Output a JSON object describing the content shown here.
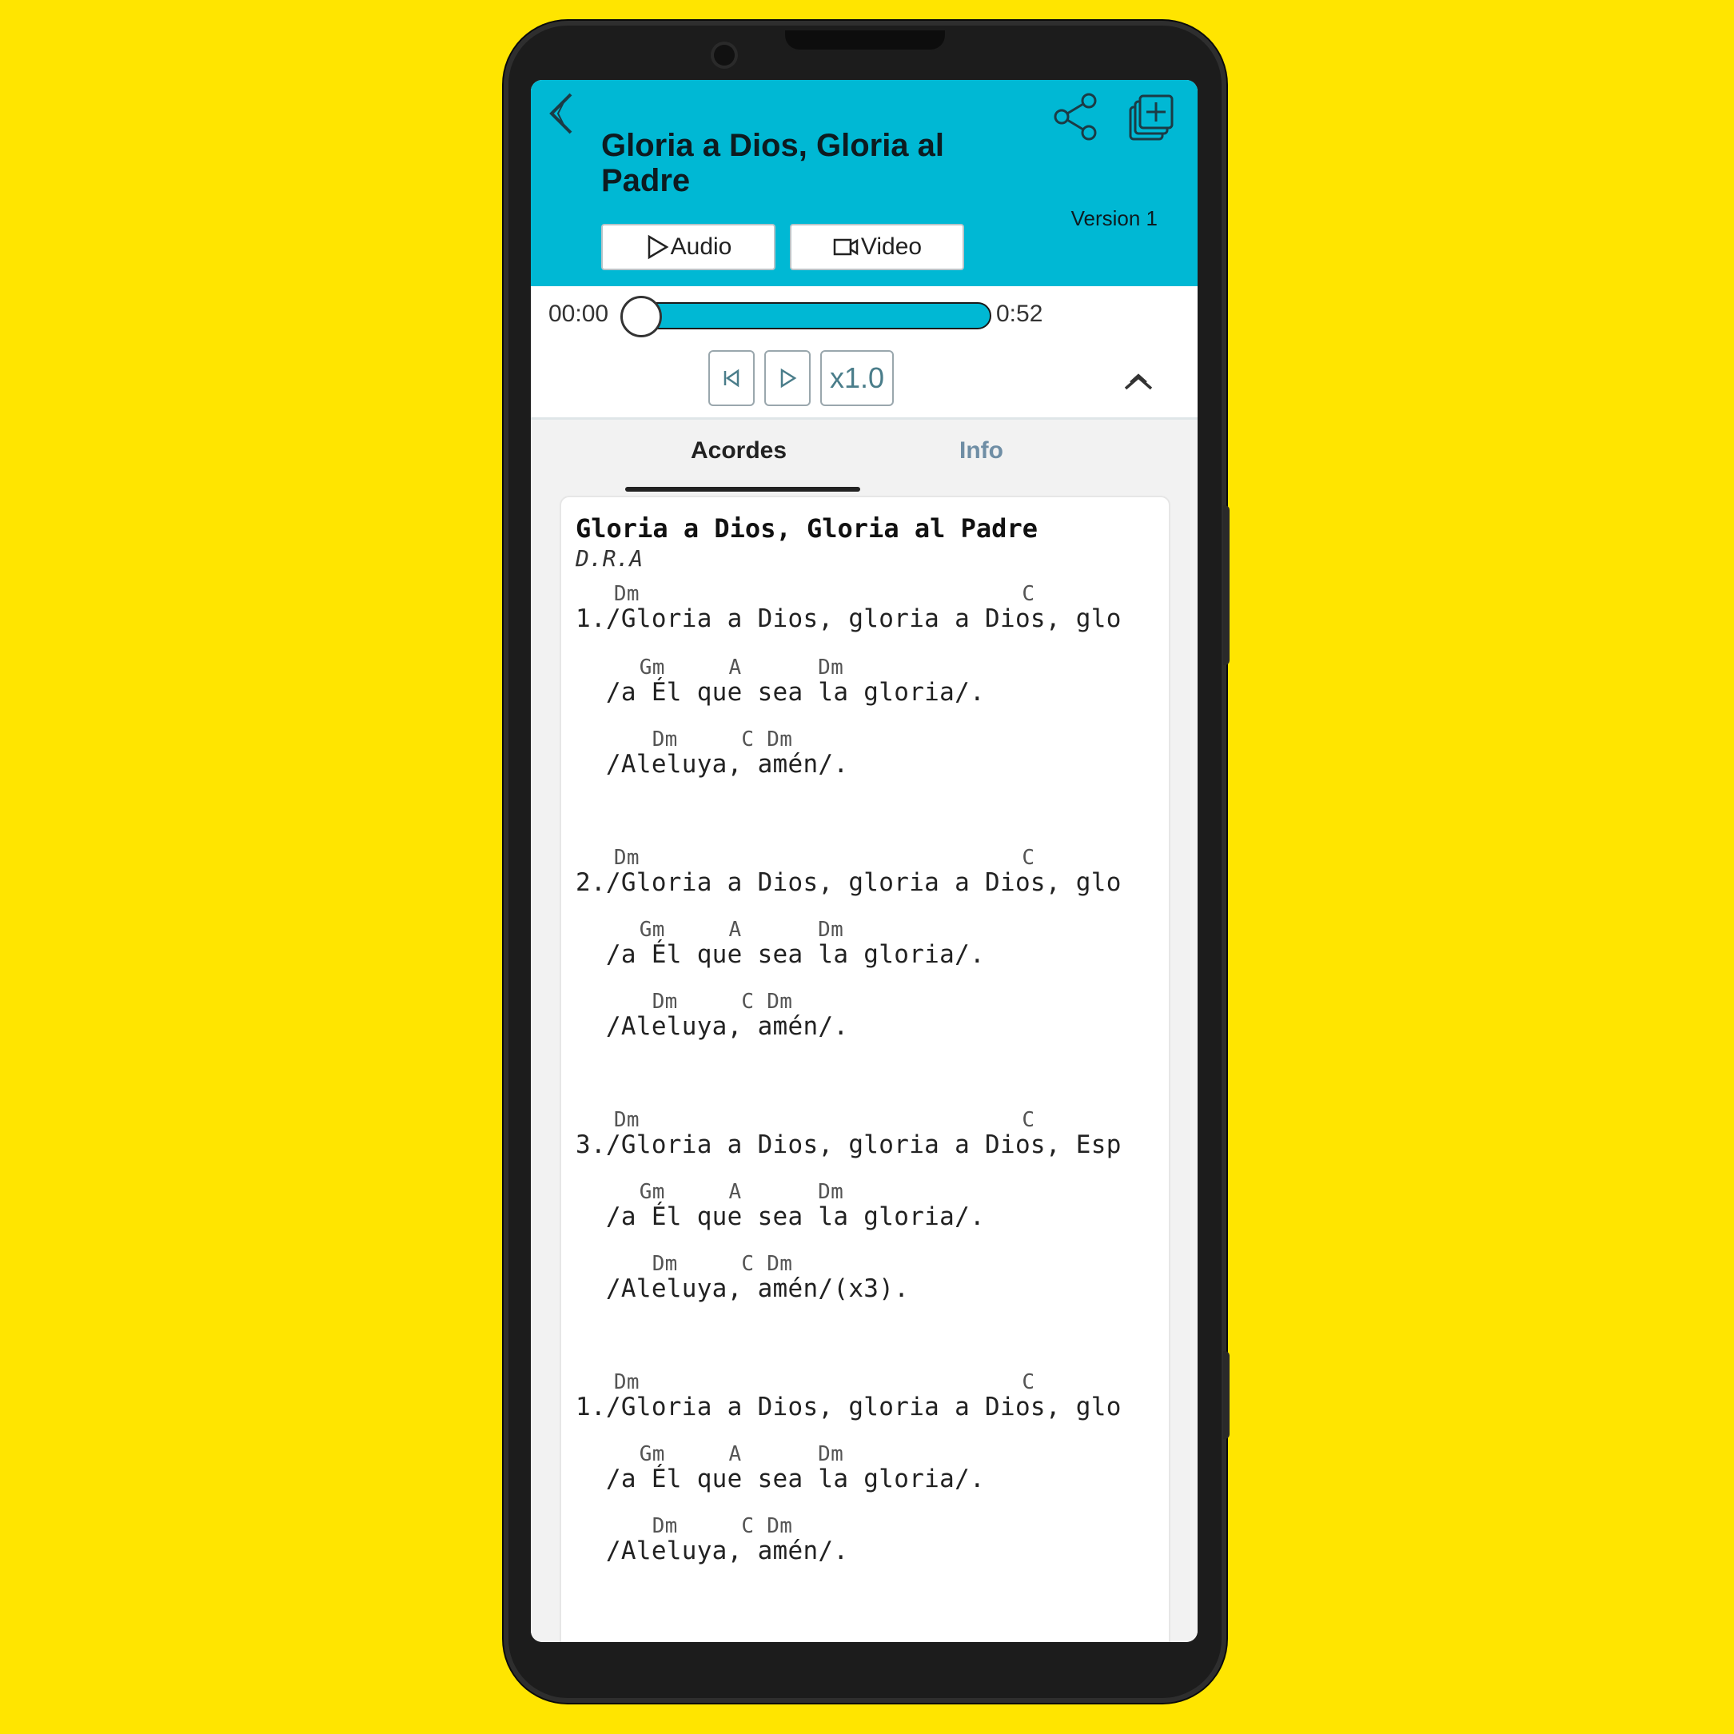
{
  "header": {
    "title": "Gloria a Dios, Gloria al Padre",
    "version": "Version 1",
    "audio_label": "Audio",
    "video_label": "Video"
  },
  "player": {
    "current_time": "00:00",
    "total_time": "0:52",
    "speed": "x1.0",
    "progress": 0
  },
  "tabs": [
    {
      "label": "Acordes",
      "active": true
    },
    {
      "label": "Info",
      "active": false
    }
  ],
  "song": {
    "title": "Gloria a Dios, Gloria al Padre",
    "author": "D.R.A",
    "lines": [
      {
        "chords": "   Dm                              C",
        "text": "1./Gloria a Dios, gloria a Dios, glo"
      },
      {
        "chords": "     Gm     A      Dm",
        "text": "  /a Él que sea la gloria/."
      },
      {
        "chords": "      Dm     C Dm",
        "text": "  /Aleluya, amén/."
      },
      {
        "chords": "   Dm                              C",
        "text": "2./Gloria a Dios, gloria a Dios, glo"
      },
      {
        "chords": "     Gm     A      Dm",
        "text": "  /a Él que sea la gloria/."
      },
      {
        "chords": "      Dm     C Dm",
        "text": "  /Aleluya, amén/."
      },
      {
        "chords": "   Dm                              C",
        "text": "3./Gloria a Dios, gloria a Dios, Esp"
      },
      {
        "chords": "     Gm     A      Dm",
        "text": "  /a Él que sea la gloria/."
      },
      {
        "chords": "      Dm     C Dm",
        "text": "  /Aleluya, amén/(x3)."
      },
      {
        "chords": "   Dm                              C",
        "text": "1./Gloria a Dios, gloria a Dios, glo"
      },
      {
        "chords": "     Gm     A      Dm",
        "text": "  /a Él que sea la gloria/."
      },
      {
        "chords": "      Dm     C Dm",
        "text": "  /Aleluya, amén/."
      }
    ]
  },
  "colors": {
    "background": "#FFE500",
    "accent": "#00B8D4"
  }
}
